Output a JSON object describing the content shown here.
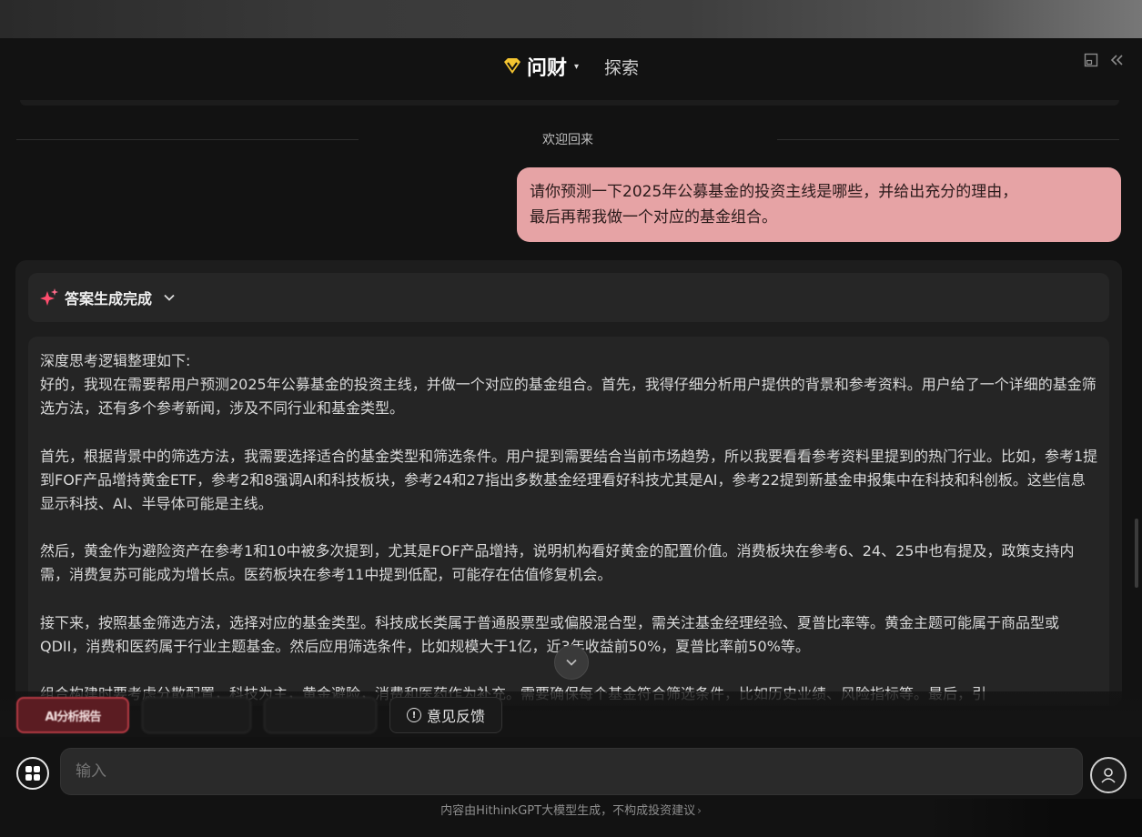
{
  "header": {
    "brand_name": "问财",
    "brand_caret": "▾",
    "explore_label": "探索",
    "layout_icon": "layout-icon",
    "collapse_icon": "double-chevron-left-icon",
    "accent_color": "#f4c430"
  },
  "chat": {
    "welcome": "欢迎回来",
    "user_message_line1": "请你预测一下2025年公募基金的投资主线是哪些，并给出充分的理由，",
    "user_message_line2": "最后再帮我做一个对应的基金组合。",
    "user_bubble_color": "#e6a3a5"
  },
  "answer": {
    "status_label": "答案生成完成",
    "status_chevron": "⌄",
    "thinking_title": "深度思考逻辑整理如下:",
    "paragraphs": [
      "好的，我现在需要帮用户预测2025年公募基金的投资主线，并做一个对应的基金组合。首先，我得仔细分析用户提供的背景和参考资料。用户给了一个详细的基金筛选方法，还有多个参考新闻，涉及不同行业和基金类型。",
      "首先，根据背景中的筛选方法，我需要选择适合的基金类型和筛选条件。用户提到需要结合当前市场趋势，所以我要看看参考资料里提到的热门行业。比如，参考1提到FOF产品增持黄金ETF，参考2和8强调AI和科技板块，参考24和27指出多数基金经理看好科技尤其是AI，参考22提到新基金申报集中在科技和科创板。这些信息显示科技、AI、半导体可能是主线。",
      "然后，黄金作为避险资产在参考1和10中被多次提到，尤其是FOF产品增持，说明机构看好黄金的配置价值。消费板块在参考6、24、25中也有提及，政策支持内需，消费复苏可能成为增长点。医药板块在参考11中提到低配，可能存在估值修复机会。",
      "接下来，按照基金筛选方法，选择对应的基金类型。科技成长类属于普通股票型或偏股混合型，需关注基金经理经验、夏普比率等。黄金主题可能属于商品型或QDII，消费和医药属于行业主题基金。然后应用筛选条件，比如规模大于1亿，近3年收益前50%，夏普比率前50%等。",
      "组合构建时要考虑分散配置，科技为主，黄金避险，消费和医药作为补充。需要确保每个基金符合筛选条件，比如历史业绩、风险指标等。最后，引"
    ]
  },
  "actions": {
    "feedback_label": "意见反馈",
    "red_chip_label": "AI分析报告"
  },
  "input": {
    "placeholder": "输入"
  },
  "footer": {
    "disclaimer": "内容由HithinkGPT大模型生成，不构成投资建议",
    "chevron": "›"
  }
}
